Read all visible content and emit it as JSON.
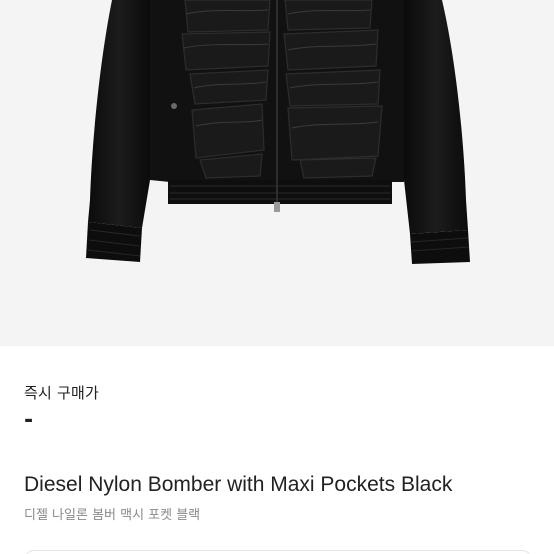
{
  "product": {
    "image_alt": "Diesel Nylon Bomber with Maxi Pockets Black",
    "image_background": "#f4f4f4",
    "jacket_color": "#111111"
  },
  "price": {
    "label": "즉시 구매가",
    "value": "-"
  },
  "title": {
    "name_en": "Diesel Nylon Bomber with Maxi Pockets Black",
    "name_ko": "디젤 나일론 봄버 맥시 포켓 블랙"
  }
}
